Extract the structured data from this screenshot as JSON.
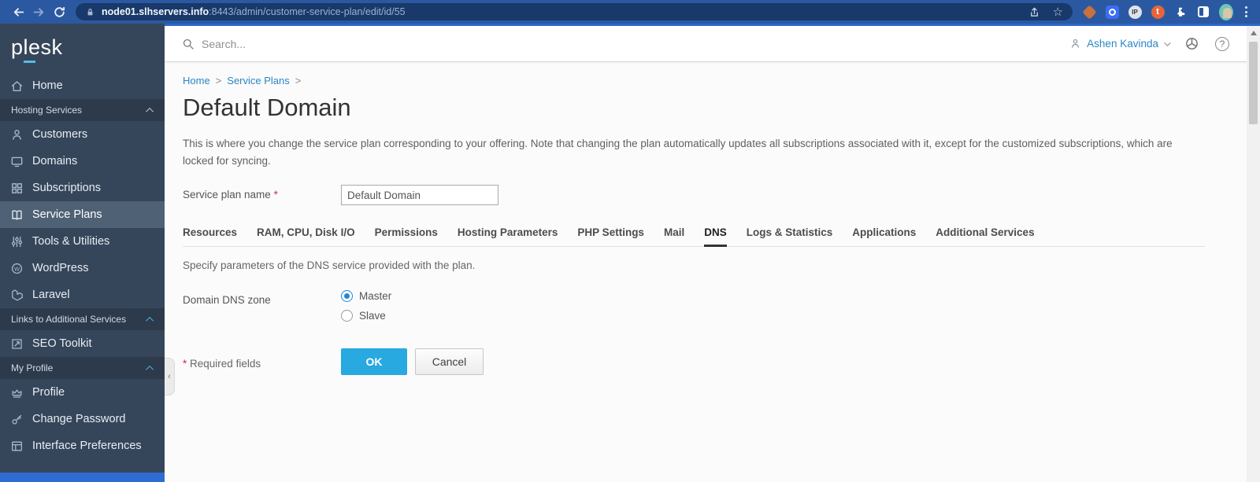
{
  "browser": {
    "url_host": "node01.slhservers.info",
    "url_path": ":8443/admin/customer-service-plan/edit/id/55",
    "star_glyph": "☆",
    "ext_ip_label": "IP",
    "ext_t_label": "t"
  },
  "sidebar": {
    "logo": "plesk",
    "items": [
      {
        "label": "Home"
      },
      {
        "label": "Hosting Services"
      },
      {
        "label": "Customers"
      },
      {
        "label": "Domains"
      },
      {
        "label": "Subscriptions"
      },
      {
        "label": "Service Plans"
      },
      {
        "label": "Tools & Utilities"
      },
      {
        "label": "WordPress"
      },
      {
        "label": "Laravel"
      },
      {
        "label": "Links to Additional Services"
      },
      {
        "label": "SEO Toolkit"
      },
      {
        "label": "My Profile"
      },
      {
        "label": "Profile"
      },
      {
        "label": "Change Password"
      },
      {
        "label": "Interface Preferences"
      }
    ],
    "collapse_glyph": "‹"
  },
  "topbar": {
    "search_placeholder": "Search...",
    "user_name": "Ashen Kavinda",
    "help_glyph": "?"
  },
  "page": {
    "breadcrumb": [
      {
        "label": "Home"
      },
      {
        "label": "Service Plans"
      }
    ],
    "separator": ">",
    "title": "Default Domain",
    "description": "This is where you change the service plan corresponding to your offering. Note that changing the plan automatically updates all subscriptions associated with it, except for the customized subscriptions, which are locked for syncing.",
    "form": {
      "plan_name_label": "Service plan name",
      "required_mark": "*",
      "plan_name_value": "Default Domain"
    },
    "tabs": [
      {
        "label": "Resources"
      },
      {
        "label": "RAM, CPU, Disk I/O"
      },
      {
        "label": "Permissions"
      },
      {
        "label": "Hosting Parameters"
      },
      {
        "label": "PHP Settings"
      },
      {
        "label": "Mail"
      },
      {
        "label": "DNS",
        "active": true
      },
      {
        "label": "Logs & Statistics"
      },
      {
        "label": "Applications"
      },
      {
        "label": "Additional Services"
      }
    ],
    "dns": {
      "description": "Specify parameters of the DNS service provided with the plan.",
      "zone_label": "Domain DNS zone",
      "options": [
        {
          "label": "Master",
          "selected": true
        },
        {
          "label": "Slave",
          "selected": false
        }
      ]
    },
    "required_note": "Required fields",
    "ok_label": "OK",
    "cancel_label": "Cancel"
  },
  "colors": {
    "chrome_bg": "#2b59a1",
    "sidebar_bg": "#36465a",
    "sidebar_active": "#4e6175",
    "link_blue": "#2a87c6",
    "primary_button": "#28a9e0",
    "radio_selected": "#1e87d8"
  }
}
